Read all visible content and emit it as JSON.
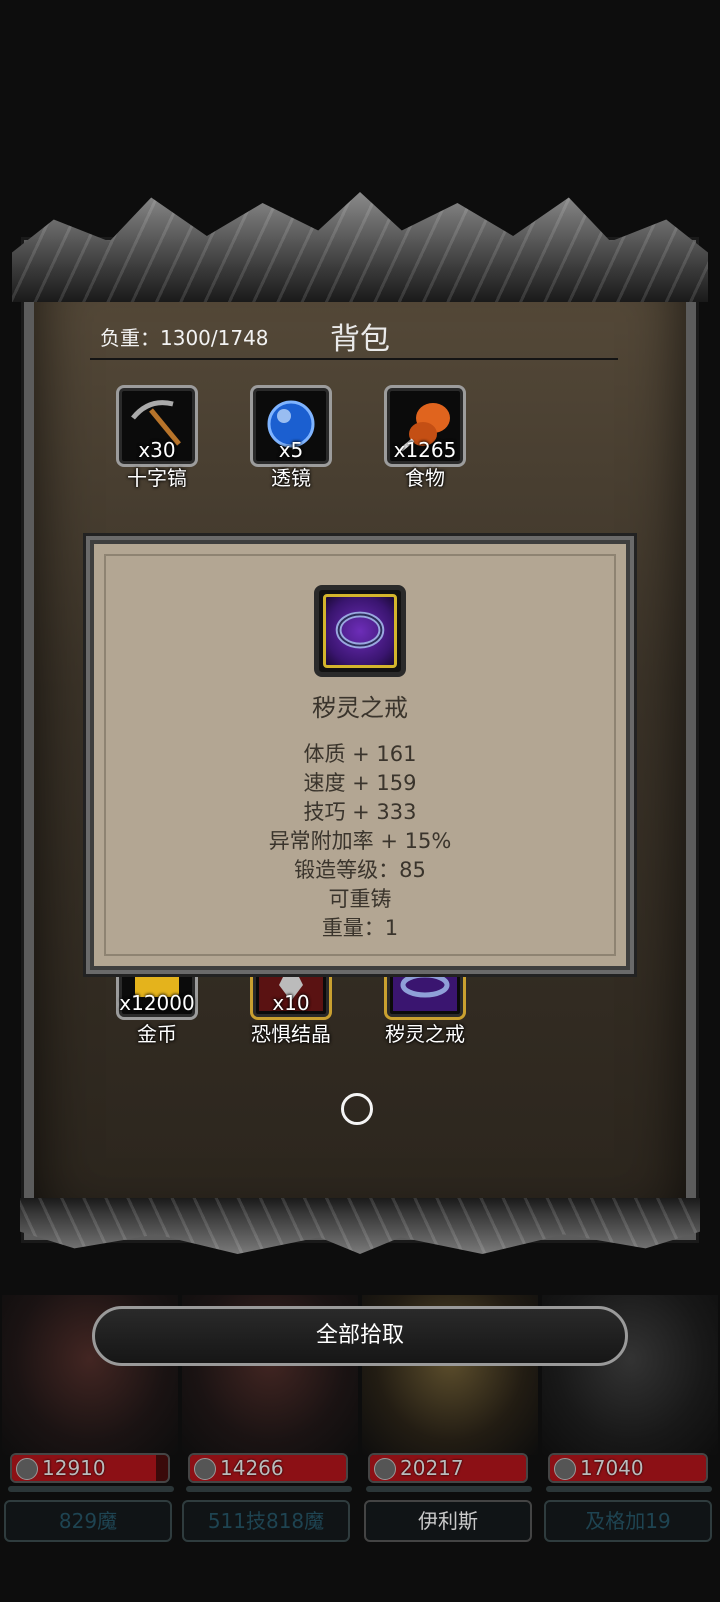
{
  "backpack": {
    "title": "背包",
    "weight": "负重：1300/1748",
    "items_row1": [
      {
        "name": "十字镐",
        "qty": "x30",
        "icon": "pickaxe-icon"
      },
      {
        "name": "透镜",
        "qty": "x5",
        "icon": "lens-icon"
      },
      {
        "name": "食物",
        "qty": "x1265",
        "icon": "food-icon"
      }
    ],
    "items_row2": [
      {
        "name": "金币",
        "qty": "x12000",
        "icon": "gold-coin-icon"
      },
      {
        "name": "恐惧结晶",
        "qty": "x10",
        "icon": "fear-crystal-icon"
      },
      {
        "name": "秽灵之戒",
        "qty": "",
        "icon": "ring-icon"
      }
    ]
  },
  "tooltip": {
    "name": "秽灵之戒",
    "icon": "ring-icon",
    "stats": [
      "体质 + 161",
      "速度 + 159",
      "技巧 + 333",
      "异常附加率 + 15%",
      "锻造等级：85",
      "可重铸",
      "重量：1"
    ]
  },
  "pickup_button": "全部拾取",
  "party": [
    {
      "hp": "12910",
      "hp_fill": 0.92,
      "name": "829魔",
      "active": false
    },
    {
      "hp": "14266",
      "hp_fill": 1.0,
      "name": "511技818魔",
      "active": false
    },
    {
      "hp": "20217",
      "hp_fill": 1.0,
      "name": "伊利斯",
      "active": true
    },
    {
      "hp": "17040",
      "hp_fill": 1.0,
      "name": "及格加19",
      "active": false
    }
  ],
  "colors": {
    "rarity_epic": "#d4b52c",
    "hp": "#8c1015"
  }
}
